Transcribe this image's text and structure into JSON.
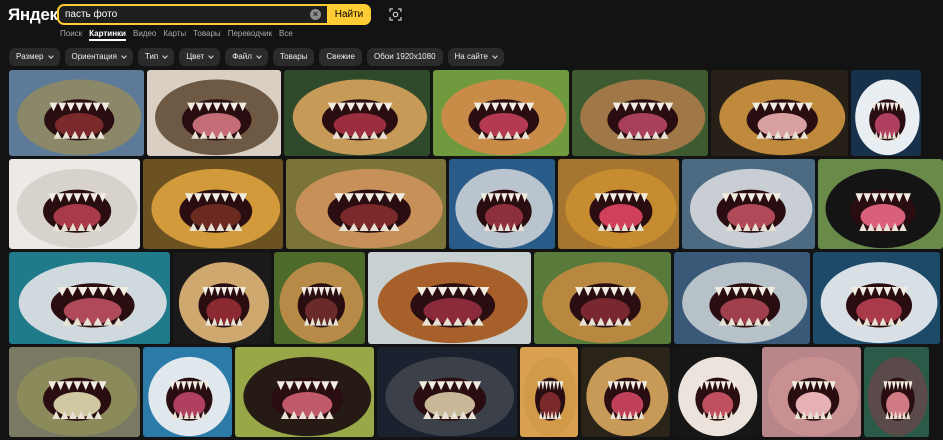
{
  "header": {
    "logo": "Яндекс",
    "search_value": "пасть фото",
    "search_button": "Найти"
  },
  "tabs": [
    {
      "label": "Поиск",
      "active": false
    },
    {
      "label": "Картинки",
      "active": true
    },
    {
      "label": "Видео",
      "active": false
    },
    {
      "label": "Карты",
      "active": false
    },
    {
      "label": "Товары",
      "active": false
    },
    {
      "label": "Переводчик",
      "active": false
    },
    {
      "label": "Все",
      "active": false
    }
  ],
  "filters": [
    {
      "label": "Размер",
      "dropdown": true
    },
    {
      "label": "Ориентация",
      "dropdown": true
    },
    {
      "label": "Тип",
      "dropdown": true
    },
    {
      "label": "Цвет",
      "dropdown": true
    },
    {
      "label": "Файл",
      "dropdown": true
    },
    {
      "label": "Товары",
      "dropdown": false
    },
    {
      "label": "Свежие",
      "dropdown": false
    },
    {
      "label": "Обои 1920x1080",
      "dropdown": false
    },
    {
      "label": "На сайте",
      "dropdown": true
    }
  ],
  "results": [
    [
      {
        "subject": "crocodile",
        "bg": "#5d7a98",
        "fur": "#8a8868",
        "mouth": "#7a2a2a"
      },
      {
        "subject": "dog",
        "bg": "#d9cfc2",
        "fur": "#6e5a44",
        "mouth": "#c46d76"
      },
      {
        "subject": "lion",
        "bg": "#2f4a2a",
        "fur": "#c79a58",
        "mouth": "#9a2d3e"
      },
      {
        "subject": "lion",
        "bg": "#6f9a3e",
        "fur": "#c88c48",
        "mouth": "#b33a52"
      },
      {
        "subject": "lion",
        "bg": "#3d5a30",
        "fur": "#a07848",
        "mouth": "#a8405a"
      },
      {
        "subject": "crocodile",
        "bg": "#262018",
        "fur": "#c08a3c",
        "mouth": "#d8a0a0"
      },
      {
        "subject": "shark",
        "bg": "#17314a",
        "fur": "#e8eef2",
        "mouth": "#b04060"
      }
    ],
    [
      {
        "subject": "tiger",
        "bg": "#ece9e6",
        "fur": "#d8d2cc",
        "mouth": "#a83a4a"
      },
      {
        "subject": "lion",
        "bg": "#6b5220",
        "fur": "#d29a3a",
        "mouth": "#6a2a20"
      },
      {
        "subject": "lion",
        "bg": "#7a7438",
        "fur": "#c69058",
        "mouth": "#7a2a2a"
      },
      {
        "subject": "shark",
        "bg": "#2a5c8a",
        "fur": "#b9c4ce",
        "mouth": "#8e2f3c"
      },
      {
        "subject": "lion",
        "bg": "#a67630",
        "fur": "#c88c30",
        "mouth": "#d0405a"
      },
      {
        "subject": "shark",
        "bg": "#4c6a82",
        "fur": "#c8ced4",
        "mouth": "#b04a58"
      },
      {
        "subject": "cat",
        "bg": "#6a8a4a",
        "fur": "#141414",
        "mouth": "#d8607a"
      }
    ],
    [
      {
        "subject": "shark",
        "bg": "#1f7a8a",
        "fur": "#d0dade",
        "mouth": "#b04a5a"
      },
      {
        "subject": "tiger",
        "bg": "#1a1a1a",
        "fur": "#cfa870",
        "mouth": "#8a2a30"
      },
      {
        "subject": "lion",
        "bg": "#4d6a2a",
        "fur": "#b88a48",
        "mouth": "#6a2a2a"
      },
      {
        "subject": "lion",
        "bg": "#c9d0d2",
        "fur": "#a8602a",
        "mouth": "#8a2a3a"
      },
      {
        "subject": "lion",
        "bg": "#587a3a",
        "fur": "#b88840",
        "mouth": "#7a2830"
      },
      {
        "subject": "shark",
        "bg": "#3a5878",
        "fur": "#b7c1c8",
        "mouth": "#a0404c"
      },
      {
        "subject": "shark",
        "bg": "#1e4a6a",
        "fur": "#d8e0e6",
        "mouth": "#a83a4a"
      }
    ],
    [
      {
        "subject": "crocodile",
        "bg": "#7a7a64",
        "fur": "#8a8a5a",
        "mouth": "#d0c8a0"
      },
      {
        "subject": "shark",
        "bg": "#2c7aa8",
        "fur": "#e0e8ee",
        "mouth": "#b04060"
      },
      {
        "subject": "dog",
        "bg": "#98a848",
        "fur": "#261a14",
        "mouth": "#c05a6a"
      },
      {
        "subject": "seal",
        "bg": "#1a2230",
        "fur": "#3c4048",
        "mouth": "#c8b898"
      },
      {
        "subject": "lion",
        "bg": "#d8a050",
        "fur": "#d09a48",
        "mouth": "#7a2a2a"
      },
      {
        "subject": "lion",
        "bg": "#2a2418",
        "fur": "#c89a58",
        "mouth": "#c0405a"
      },
      {
        "subject": "dog",
        "bg": "#161616",
        "fur": "#ece4dc",
        "mouth": "#c05060"
      },
      {
        "subject": "hippo",
        "bg": "#b8868a",
        "fur": "#c89090",
        "mouth": "#e6b0b4"
      },
      {
        "subject": "hippo",
        "bg": "#2a5a48",
        "fur": "#5a4a4a",
        "mouth": "#d07a84"
      }
    ]
  ]
}
